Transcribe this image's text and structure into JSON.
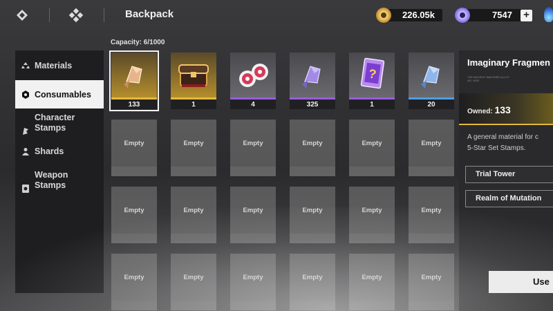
{
  "topbar": {
    "menu_icon": "menu-diamond-icon",
    "home_icon": "diamond-grid-icon",
    "title": "Backpack",
    "gold": {
      "icon": "gold-coin-icon",
      "value": "226.05k",
      "color": "#d9a441"
    },
    "gems": {
      "icon": "purple-ring-icon",
      "value": "7547",
      "color": "#8e7cf0"
    },
    "add_label": "+",
    "flame_icon": "blue-flame-icon"
  },
  "sidebar": {
    "items": [
      {
        "label": "Materials",
        "icon": "materials-icon"
      },
      {
        "label": "Consumables",
        "icon": "consumables-icon"
      },
      {
        "label": "Character\nStamps",
        "icon": "character-stamps-icon"
      },
      {
        "label": "Shards",
        "icon": "shards-icon"
      },
      {
        "label": "Weapon\nStamps",
        "icon": "weapon-stamps-icon"
      }
    ],
    "active": "Consumables"
  },
  "inventory": {
    "capacity": "Capacity: 6/1000",
    "items": [
      {
        "name": "imaginary-fragment",
        "count": "133",
        "rarity_color": "#e3b93e",
        "selected": true
      },
      {
        "name": "treasure-chest",
        "count": "1",
        "rarity_color": "#e3b93e"
      },
      {
        "name": "red-orbs",
        "count": "4",
        "rarity_color": "#9b5ce0"
      },
      {
        "name": "purple-fragment",
        "count": "325",
        "rarity_color": "#9b5ce0"
      },
      {
        "name": "mystery-card",
        "count": "1",
        "rarity_color": "#9b5ce0"
      },
      {
        "name": "blue-fragment",
        "count": "20",
        "rarity_color": "#4aa0e8"
      }
    ],
    "empty_label": "Empty"
  },
  "detail": {
    "title": "Imaginary Fragmen",
    "subtitle_lines": [
      "THE ANCIENT IMAGINED ALLOY",
      "NO. 0000"
    ],
    "owned_label": "Owned:",
    "owned_value": "133",
    "description_lines": [
      "A general material for c",
      "5-Star Set Stamps."
    ],
    "sources": [
      "Trial Tower",
      "Realm of Mutation"
    ],
    "use_label": "Use"
  }
}
